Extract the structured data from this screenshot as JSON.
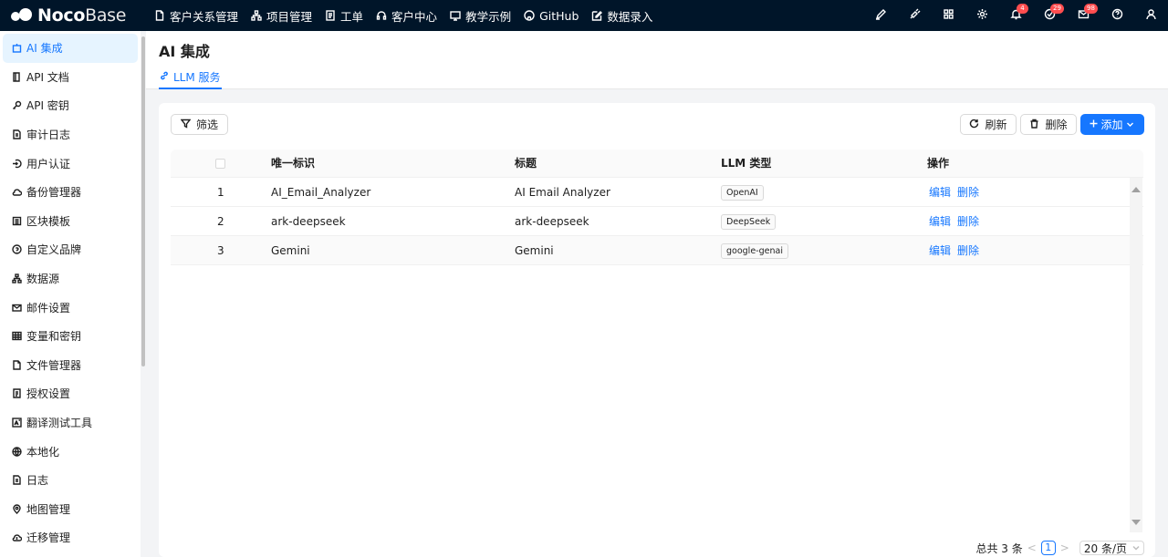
{
  "brand": {
    "bold": "Noco",
    "light": "Base"
  },
  "topnav": [
    {
      "label": "客户关系管理",
      "icon": "file-icon"
    },
    {
      "label": "项目管理",
      "icon": "apartment-icon"
    },
    {
      "label": "工单",
      "icon": "form-icon"
    },
    {
      "label": "客户中心",
      "icon": "headset-icon"
    },
    {
      "label": "教学示例",
      "icon": "desktop-icon"
    },
    {
      "label": "GitHub",
      "icon": "github-icon"
    },
    {
      "label": "数据录入",
      "icon": "edit-icon"
    }
  ],
  "topright": {
    "notifications_badge": "4",
    "tasks_badge": "29",
    "mail_badge": "98"
  },
  "sidebar": {
    "items": [
      {
        "label": "AI 集成",
        "icon": "robot-icon",
        "active": true
      },
      {
        "label": "API 文档",
        "icon": "book-icon"
      },
      {
        "label": "API 密钥",
        "icon": "key-icon"
      },
      {
        "label": "审计日志",
        "icon": "audit-icon"
      },
      {
        "label": "用户认证",
        "icon": "login-icon"
      },
      {
        "label": "备份管理器",
        "icon": "cloud-icon"
      },
      {
        "label": "区块模板",
        "icon": "template-icon"
      },
      {
        "label": "自定义品牌",
        "icon": "copyright-icon"
      },
      {
        "label": "数据源",
        "icon": "database-icon"
      },
      {
        "label": "邮件设置",
        "icon": "mail-icon"
      },
      {
        "label": "变量和密钥",
        "icon": "table-icon"
      },
      {
        "label": "文件管理器",
        "icon": "file-icon"
      },
      {
        "label": "授权设置",
        "icon": "license-icon"
      },
      {
        "label": "翻译测试工具",
        "icon": "translate-icon"
      },
      {
        "label": "本地化",
        "icon": "global-icon"
      },
      {
        "label": "日志",
        "icon": "log-icon"
      },
      {
        "label": "地图管理",
        "icon": "map-pin-icon"
      },
      {
        "label": "迁移管理",
        "icon": "migrate-icon"
      }
    ]
  },
  "page": {
    "title": "AI 集成",
    "tab_label": "LLM 服务"
  },
  "toolbar": {
    "filter_label": "筛选",
    "refresh_label": "刷新",
    "delete_label": "删除",
    "add_label": "添加"
  },
  "table": {
    "columns": [
      "唯一标识",
      "标题",
      "LLM 类型",
      "操作"
    ],
    "rows": [
      {
        "index": "1",
        "name": "AI_Email_Analyzer",
        "title": "AI Email Analyzer",
        "type": "OpenAI",
        "edit": "编辑",
        "delete": "删除"
      },
      {
        "index": "2",
        "name": "ark-deepseek",
        "title": "ark-deepseek",
        "type": "DeepSeek",
        "edit": "编辑",
        "delete": "删除"
      },
      {
        "index": "3",
        "name": "Gemini",
        "title": "Gemini",
        "type": "google-genai",
        "edit": "编辑",
        "delete": "删除"
      }
    ]
  },
  "pagination": {
    "total_label": "总共 3 条",
    "prev": "<",
    "current_page": "1",
    "next": ">",
    "page_size": "20 条/页"
  },
  "colors": {
    "topbar": "#001529",
    "primary": "#1677ff",
    "badge": "#ff4d4f"
  }
}
